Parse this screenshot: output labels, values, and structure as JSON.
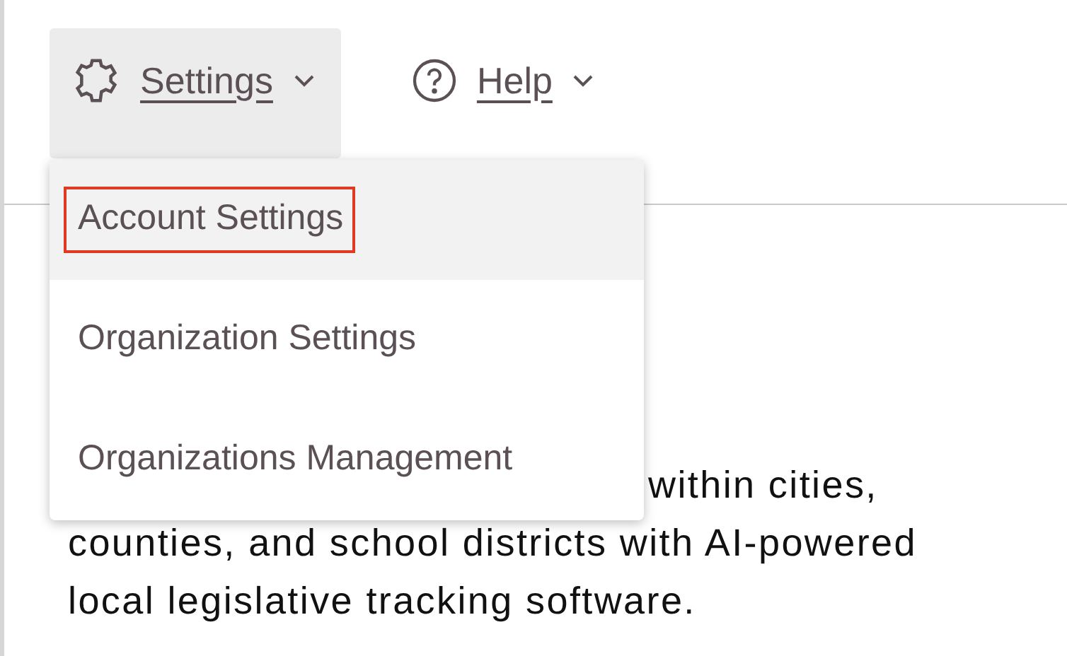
{
  "nav": [
    {
      "label": "Settings",
      "kind": "gear",
      "expanded": true
    },
    {
      "label": "Help",
      "kind": "help",
      "expanded": false
    }
  ],
  "menu": {
    "items": [
      {
        "label": "Account Settings",
        "selected": true
      },
      {
        "label": "Organization Settings",
        "selected": false
      },
      {
        "label": "Organizations Management",
        "selected": false
      }
    ]
  },
  "description": {
    "lines": [
      "within cities,",
      "counties, and school districts with AI-powered",
      "local legislative tracking software."
    ]
  }
}
